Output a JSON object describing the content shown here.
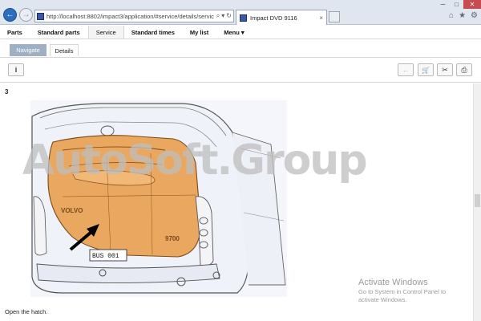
{
  "browser": {
    "url": "http://localhost:8802/impact3/application/#service/details/servic",
    "tab_title": "Impact DVD 9116",
    "tab_close": "×",
    "back_glyph": "←",
    "forward_glyph": "→",
    "address_icons": [
      "⌕",
      "▾",
      "↻"
    ],
    "window_controls": [
      "─",
      "□",
      "✕"
    ],
    "chrome_icons": [
      "⌂",
      "★",
      "⚙"
    ]
  },
  "menu": {
    "items": [
      {
        "label": "Parts"
      },
      {
        "label": "Standard parts"
      },
      {
        "label": "Service"
      },
      {
        "label": "Standard times"
      },
      {
        "label": "My list"
      },
      {
        "label": "Menu ▾"
      }
    ]
  },
  "subtabs": {
    "navigate": "Navigate",
    "details": "Details"
  },
  "toolbar": {
    "info": "i",
    "back": "←",
    "cart": "🛒",
    "tools": "✂",
    "print": "⎙"
  },
  "content": {
    "step_number": "3",
    "caption": "Open the hatch.",
    "plate_text": "BUS 001",
    "brand_text": "VOLVO",
    "model_text": "9700"
  },
  "watermark": {
    "text": "AutoSoft.Group"
  },
  "activation": {
    "title": "Activate Windows",
    "line1": "Go to System in Control Panel to",
    "line2": "activate Windows."
  },
  "colors": {
    "hatch": "#e9a760",
    "accent": "#2a6ebd"
  }
}
